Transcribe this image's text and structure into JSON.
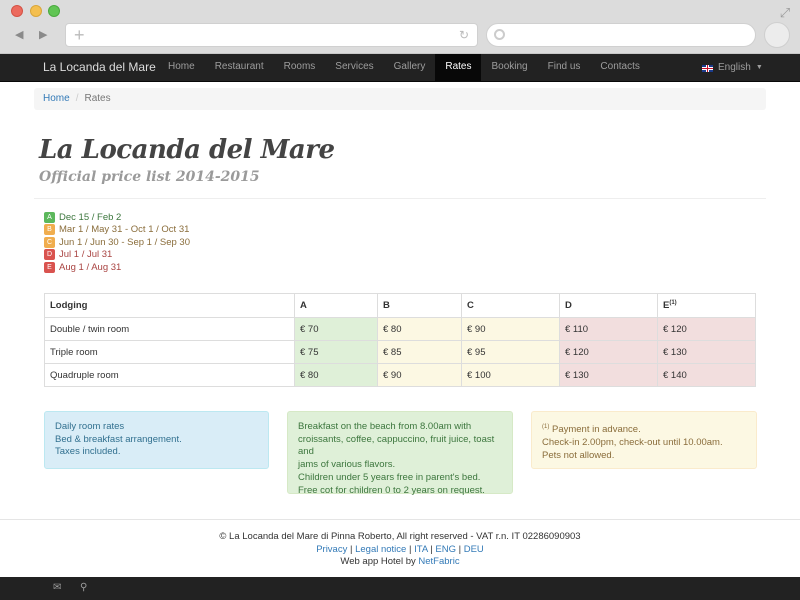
{
  "navbar": {
    "brand": "La Locanda del Mare",
    "items": [
      {
        "label": "Home"
      },
      {
        "label": "Restaurant"
      },
      {
        "label": "Rooms"
      },
      {
        "label": "Services"
      },
      {
        "label": "Gallery"
      },
      {
        "label": "Rates",
        "active": true
      },
      {
        "label": "Booking"
      },
      {
        "label": "Find us"
      },
      {
        "label": "Contacts"
      }
    ],
    "language": "English"
  },
  "breadcrumb": {
    "home": "Home",
    "current": "Rates"
  },
  "header": {
    "title": "La Locanda del Mare",
    "subtitle": "Official price list 2014-2015"
  },
  "seasons": [
    {
      "code": "A",
      "dates": "Dec 15 / Feb 2",
      "color": "#5cb85c",
      "text_color": "#3c763d"
    },
    {
      "code": "B",
      "dates": "Mar 1 / May 31 - Oct 1 / Oct 31",
      "color": "#f0ad4e",
      "text_color": "#8a6d3b"
    },
    {
      "code": "C",
      "dates": "Jun 1 / Jun 30 - Sep 1 / Sep 30",
      "color": "#f0ad4e",
      "text_color": "#8a6d3b"
    },
    {
      "code": "D",
      "dates": "Jul 1 / Jul 31",
      "color": "#d9534f",
      "text_color": "#a94442"
    },
    {
      "code": "E",
      "dates": "Aug 1 / Aug 31",
      "color": "#d9534f",
      "text_color": "#a94442"
    }
  ],
  "table": {
    "headers": [
      "Lodging",
      "A",
      "B",
      "C",
      "D",
      "E"
    ],
    "header_note": "(1)",
    "rows": [
      {
        "name": "Double / twin room",
        "prices": [
          "€ 70",
          "€ 80",
          "€ 90",
          "€ 110",
          "€ 120"
        ]
      },
      {
        "name": "Triple room",
        "prices": [
          "€ 75",
          "€ 85",
          "€ 95",
          "€ 120",
          "€ 130"
        ]
      },
      {
        "name": "Quadruple room",
        "prices": [
          "€ 80",
          "€ 90",
          "€ 100",
          "€ 130",
          "€ 140"
        ]
      }
    ]
  },
  "boxes": {
    "info": [
      "Daily room rates",
      "Bed & breakfast arrangement.",
      "Taxes included."
    ],
    "success": [
      "Breakfast on the beach from 8.00am with",
      "croissants, coffee, cappuccino, fruit juice, toast and",
      "jams of various flavors.",
      "Children under 5 years free in parent's bed.",
      "Free cot for children 0 to 2 years on request."
    ],
    "warning_note": "(1)",
    "warning": [
      "Payment in advance.",
      "Check-in 2.00pm, check-out until 10.00am.",
      "Pets not allowed."
    ]
  },
  "footer": {
    "copyright": "© La Locanda del Mare di Pinna Roberto, All right reserved - VAT r.n. IT 02286090903",
    "links": [
      "Privacy",
      "Legal notice",
      "ITA",
      "ENG",
      "DEU"
    ],
    "credit_prefix": "Web app Hotel by ",
    "credit_link": "NetFabric"
  },
  "icons": {
    "bottom_left": "envelope-icon",
    "bottom_right": "map-marker-icon"
  }
}
